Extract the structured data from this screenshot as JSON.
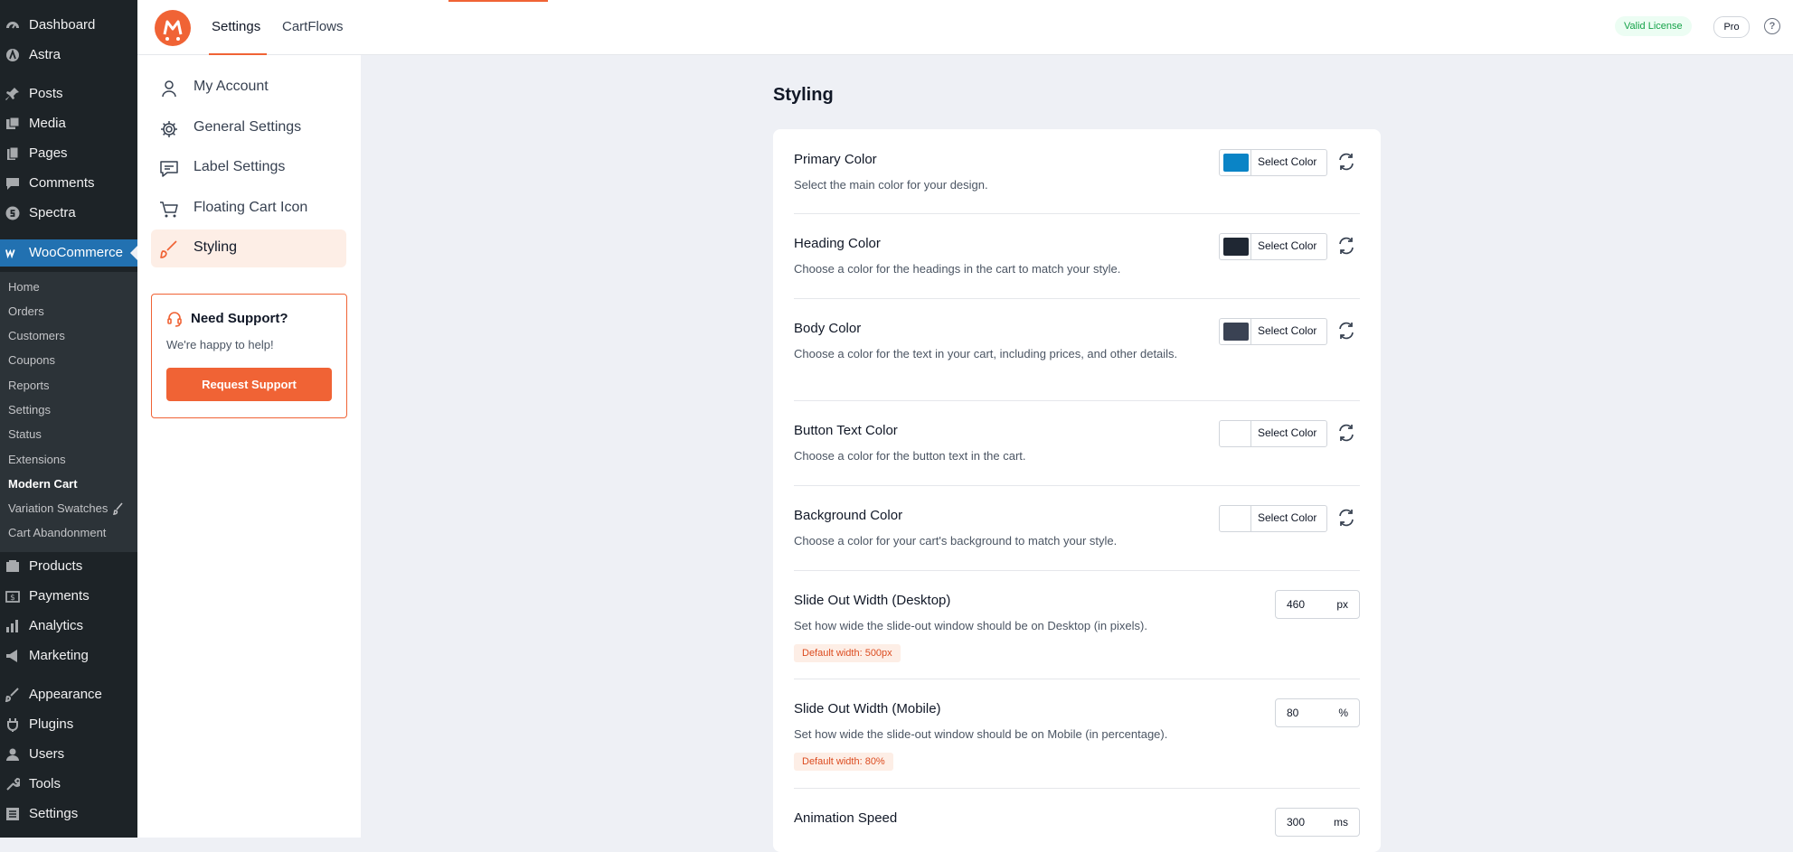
{
  "wp_menu": {
    "top": [
      {
        "label": "Dashboard",
        "icon": "dashboard-icon"
      },
      {
        "label": "Astra",
        "icon": "astra-icon"
      },
      {
        "label": "Posts",
        "icon": "pin-icon"
      },
      {
        "label": "Media",
        "icon": "media-icon"
      },
      {
        "label": "Pages",
        "icon": "pages-icon"
      },
      {
        "label": "Comments",
        "icon": "comments-icon"
      },
      {
        "label": "Spectra",
        "icon": "spectra-icon"
      },
      {
        "label": "WooCommerce",
        "icon": "woocommerce-icon"
      }
    ],
    "woo_submenu": [
      "Home",
      "Orders",
      "Customers",
      "Coupons",
      "Reports",
      "Settings",
      "Status",
      "Extensions",
      "Modern Cart",
      "Variation Swatches",
      "Cart Abandonment"
    ],
    "bottom": [
      {
        "label": "Products",
        "icon": "products-icon"
      },
      {
        "label": "Payments",
        "icon": "payments-icon"
      },
      {
        "label": "Analytics",
        "icon": "analytics-icon"
      },
      {
        "label": "Marketing",
        "icon": "marketing-icon"
      },
      {
        "label": "Appearance",
        "icon": "appearance-icon"
      },
      {
        "label": "Plugins",
        "icon": "plugins-icon"
      },
      {
        "label": "Users",
        "icon": "users-icon"
      },
      {
        "label": "Tools",
        "icon": "tools-icon"
      },
      {
        "label": "Settings",
        "icon": "settings-icon"
      }
    ]
  },
  "topbar": {
    "tabs": [
      "Settings",
      "CartFlows"
    ],
    "license": "Valid License",
    "plan": "Pro",
    "help": "?"
  },
  "plugin_nav": {
    "items": [
      "My Account",
      "General Settings",
      "Label Settings",
      "Floating Cart Icon",
      "Styling"
    ],
    "active": "Styling"
  },
  "support": {
    "title": "Need Support?",
    "text": "We're happy to help!",
    "button": "Request Support"
  },
  "main": {
    "title": "Styling",
    "color_rows": [
      {
        "title": "Primary Color",
        "desc": "Select the main color for your design.",
        "color": "#0a84c6",
        "button": "Select Color"
      },
      {
        "title": "Heading Color",
        "desc": "Choose a color for the headings in the cart to match your style.",
        "color": "#1f2733",
        "button": "Select Color"
      },
      {
        "title": "Body Color",
        "desc": "Choose a color for the text in your cart, including prices, and other details.",
        "color": "#3a4253",
        "button": "Select Color"
      },
      {
        "title": "Button Text Color",
        "desc": "Choose a color for the button text in the cart.",
        "color": "#ffffff",
        "button": "Select Color"
      },
      {
        "title": "Background Color",
        "desc": "Choose a color for your cart's background to match your style.",
        "color": "#ffffff",
        "button": "Select Color"
      }
    ],
    "number_rows": [
      {
        "title": "Slide Out Width (Desktop)",
        "desc": "Set how wide the slide-out window should be on Desktop (in pixels).",
        "value": "460",
        "unit": "px",
        "badge": "Default width: 500px"
      },
      {
        "title": "Slide Out Width (Mobile)",
        "desc": "Set how wide the slide-out window should be on Mobile (in percentage).",
        "value": "80",
        "unit": "%",
        "badge": "Default width: 80%"
      },
      {
        "title": "Animation Speed",
        "desc": "",
        "value": "300",
        "unit": "ms",
        "badge": ""
      }
    ]
  },
  "colors": {
    "accent": "#f06335",
    "wp_sidebar": "#1d2327",
    "wp_active": "#2271b1"
  }
}
